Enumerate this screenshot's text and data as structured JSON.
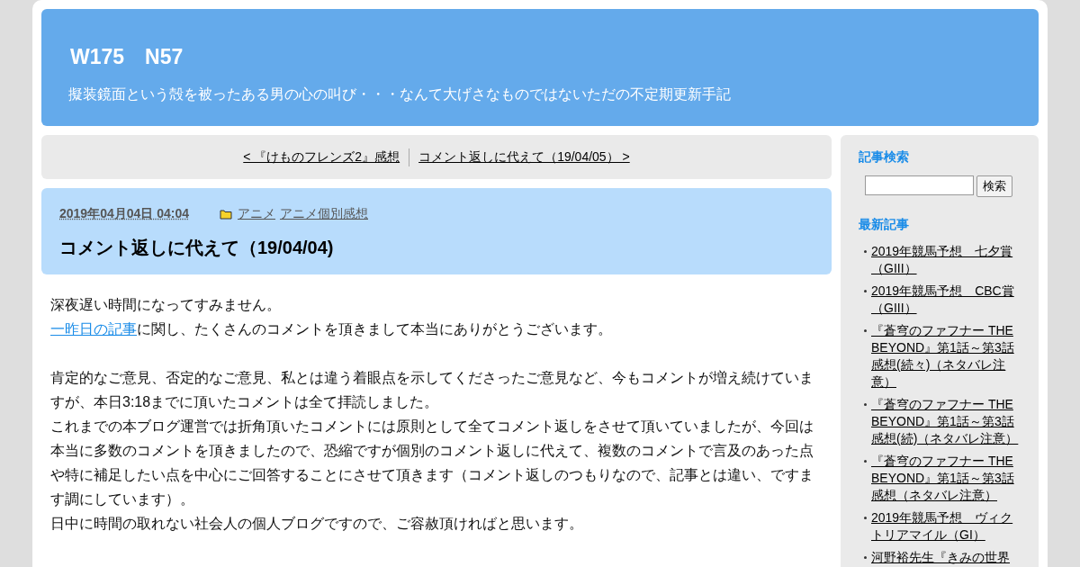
{
  "header": {
    "title": "W175　N57",
    "tagline": "擬装鏡面という殻を被ったある男の心の叫び・・・なんて大げさなものではないただの不定期更新手記"
  },
  "pager": {
    "prev": "< 『けものフレンズ2』感想",
    "next": "コメント返しに代えて（19/04/05） >"
  },
  "post": {
    "date": "2019年04月04日 04:04",
    "categories": [
      "アニメ",
      "アニメ個別感想"
    ],
    "title": "コメント返しに代えて（19/04/04)",
    "paragraphs": [
      {
        "kind": "text",
        "text": "深夜遅い時間になってすみません。"
      },
      {
        "kind": "linked",
        "link": "一昨日の記事",
        "text": "に関し、たくさんのコメントを頂きまして本当にありがとうございます。"
      },
      {
        "kind": "blank"
      },
      {
        "kind": "text",
        "text": "肯定的なご意見、否定的なご意見、私とは違う着眼点を示してくださったご意見など、今もコメントが増え続けていますが、本日3:18までに頂いたコメントは全て拝読しました。"
      },
      {
        "kind": "text",
        "text": "これまでの本ブログ運営では折角頂いたコメントには原則として全てコメント返しをさせて頂いていましたが、今回は本当に多数のコメントを頂きましたので、恐縮ですが個別のコメント返しに代えて、複数のコメントで言及のあった点や特に補足したい点を中心にご回答することにさせて頂きます（コメント返しのつもりなので、記事とは違い、ですます調にしています）。"
      },
      {
        "kind": "text",
        "text": "日中に時間の取れない社会人の個人ブログですので、ご容赦頂ければと思います。"
      }
    ]
  },
  "sidebar": {
    "search_heading": "記事検索",
    "search_button": "検索",
    "recent_heading": "最新記事",
    "recent": [
      "2019年競馬予想　七夕賞（GIII）",
      "2019年競馬予想　CBC賞（GIII）",
      "『蒼穹のファフナー THE BEYOND』第1話～第3話感想(続々)（ネタバレ注意）",
      "『蒼穹のファフナー THE BEYOND』第1話～第3話感想(続)（ネタバレ注意）",
      "『蒼穹のファフナー THE BEYOND』第1話～第3話感想（ネタバレ注意）",
      "2019年競馬予想　ヴィクトリアマイル（GI）",
      "河野裕先生『きみの世界"
    ]
  }
}
